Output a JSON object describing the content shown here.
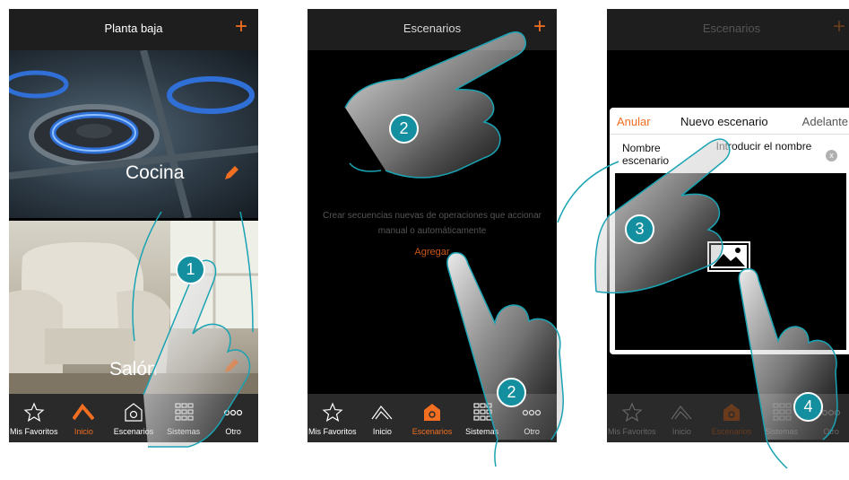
{
  "screen1": {
    "title": "Planta baja",
    "plus": "+",
    "rooms": [
      {
        "name": "Cocina",
        "icon": "pencil-icon"
      },
      {
        "name": "Salón",
        "icon": "pencil-icon"
      }
    ],
    "tabs": [
      {
        "label": "Mis Favoritos",
        "icon": "star-icon"
      },
      {
        "label": "Inicio",
        "icon": "house-icon"
      },
      {
        "label": "Escenarios",
        "icon": "scenario-icon"
      },
      {
        "label": "Sistemas",
        "icon": "grid-icon"
      },
      {
        "label": "Otro",
        "icon": "more-dots-icon"
      }
    ],
    "active_tab": "Inicio"
  },
  "screen2": {
    "title": "Escenarios",
    "plus": "+",
    "empty_message": "Crear secuencias nuevas de operaciones que accionar manual o automáticamente",
    "add_link": "Agregar",
    "tabs": [
      {
        "label": "Mis Favoritos",
        "icon": "star-icon"
      },
      {
        "label": "Inicio",
        "icon": "house-icon"
      },
      {
        "label": "Escenarios",
        "icon": "scenario-icon"
      },
      {
        "label": "Sistemas",
        "icon": "grid-icon"
      },
      {
        "label": "Otro",
        "icon": "more-dots-icon"
      }
    ],
    "active_tab": "Escenarios"
  },
  "screen3": {
    "title": "Escenarios",
    "plus": "+",
    "dialog": {
      "cancel": "Anular",
      "title": "Nuevo escenario",
      "next": "Adelante",
      "name_label": "Nombre escenario",
      "name_placeholder": "Introducir el nombre",
      "clear": "x",
      "image_icon": "image-placeholder-icon"
    },
    "tabs": [
      {
        "label": "Mis Favoritos",
        "icon": "star-icon"
      },
      {
        "label": "Inicio",
        "icon": "house-icon"
      },
      {
        "label": "Escenarios",
        "icon": "scenario-icon"
      },
      {
        "label": "Sistemas",
        "icon": "grid-icon"
      },
      {
        "label": "Otro",
        "icon": "more-dots-icon"
      }
    ],
    "active_tab": "Escenarios"
  },
  "steps": [
    "1",
    "2",
    "2",
    "3",
    "4"
  ],
  "colors": {
    "accent": "#f26f21",
    "step_badge": "#138fa0",
    "hand_outline": "#1aa3b3"
  }
}
